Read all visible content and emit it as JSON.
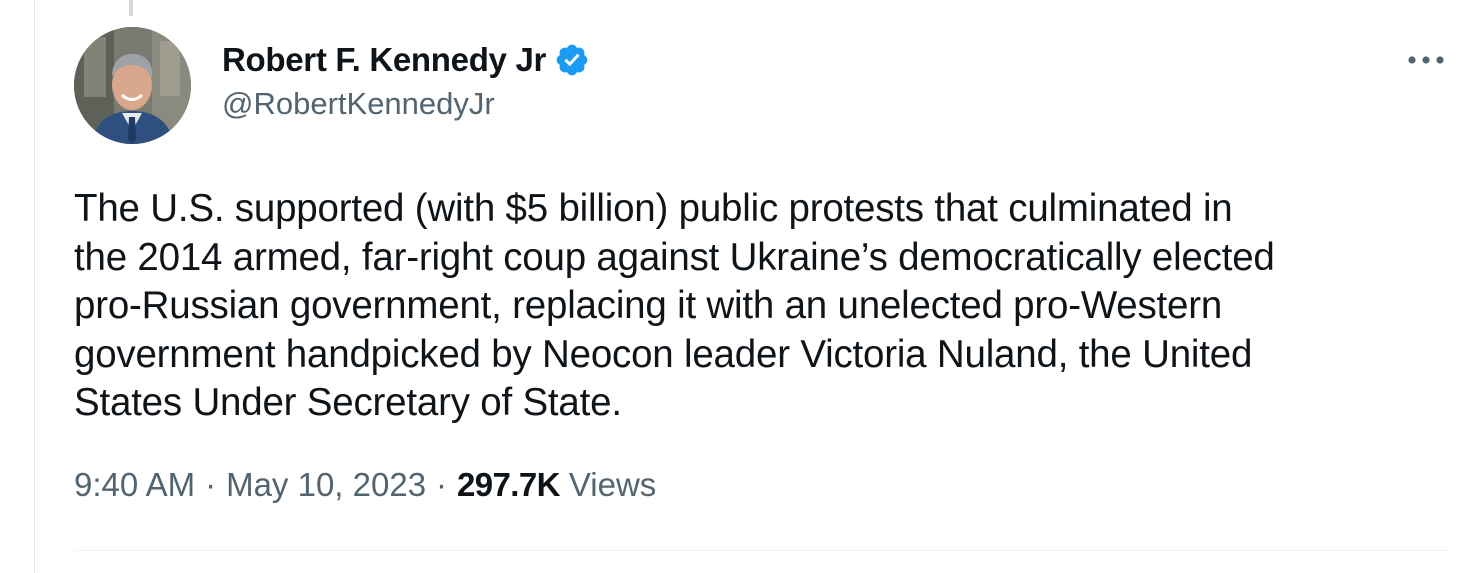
{
  "author": {
    "display_name": "Robert F. Kennedy Jr",
    "handle": "@RobertKennedyJr",
    "verified": true,
    "verified_color": "#1d9bf0",
    "avatar_icon": "avatar-photo"
  },
  "more_menu": {
    "icon": "more-horizontal-icon"
  },
  "tweet": {
    "lines": [
      "The U.S. supported (with $5 billion) public protests that culminated in",
      "the 2014 armed, far-right coup against Ukraine’s democratically elected",
      "pro-Russian government, replacing it with an unelected pro-Western",
      "government handpicked by Neocon leader Victoria Nuland, the United",
      "States Under Secretary of State."
    ]
  },
  "meta": {
    "time": "9:40 AM",
    "separator": "·",
    "date": "May 10, 2023",
    "views_count": "297.7K",
    "views_label": "Views"
  },
  "colors": {
    "text_primary": "#0f1419",
    "text_secondary": "#536471",
    "divider": "#eff3f4"
  }
}
